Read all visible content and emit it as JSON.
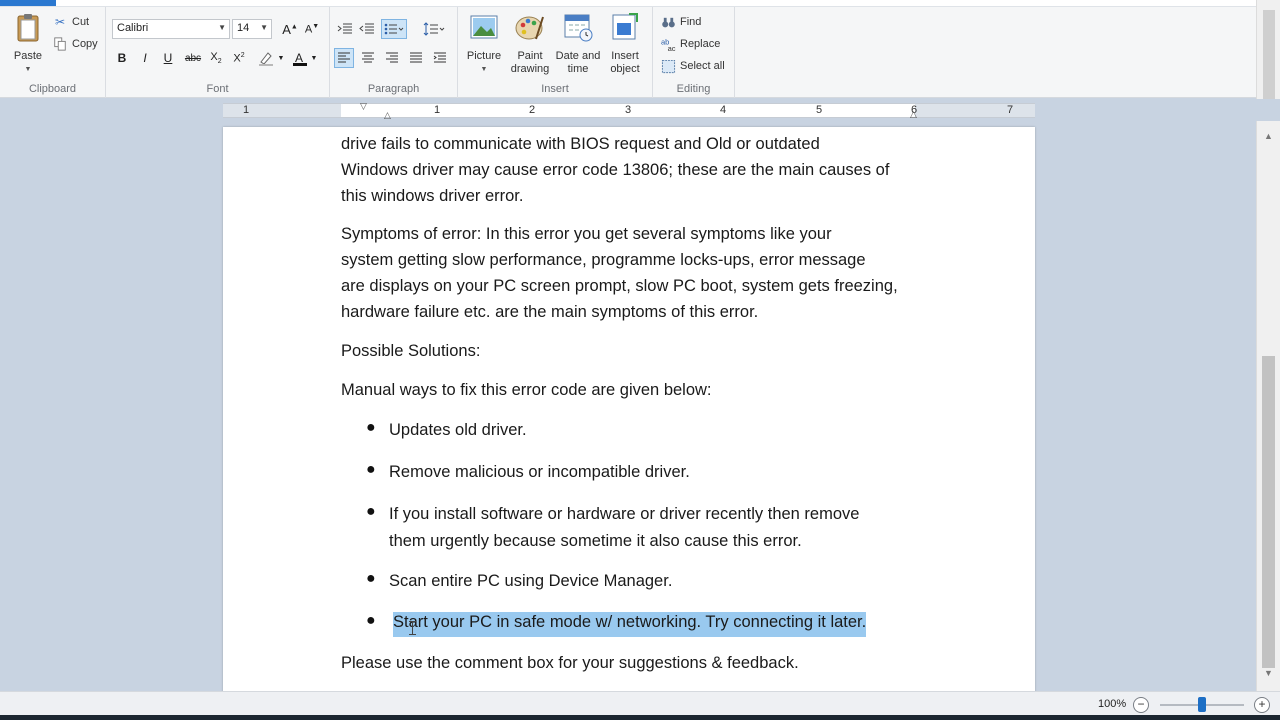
{
  "ribbon": {
    "clipboard": {
      "paste": "Paste",
      "cut": "Cut",
      "copy": "Copy",
      "label": "Clipboard"
    },
    "font": {
      "family": "Calibri",
      "size": "14",
      "label": "Font"
    },
    "paragraph": {
      "label": "Paragraph"
    },
    "insert": {
      "picture": "Picture",
      "paint_drawing": [
        "Paint",
        "drawing"
      ],
      "date_time": [
        "Date and",
        "time"
      ],
      "insert_object": [
        "Insert",
        "object"
      ],
      "label": "Insert"
    },
    "editing": {
      "find": "Find",
      "replace": "Replace",
      "select_all": "Select all",
      "label": "Editing"
    }
  },
  "ruler": {
    "numbers": [
      "1",
      "1",
      "2",
      "3",
      "4",
      "5",
      "6",
      "7"
    ]
  },
  "document": {
    "para1": [
      "drive fails to communicate with BIOS request and Old or outdated",
      "Windows driver may cause error code 13806; these are the main causes of",
      "this windows driver error."
    ],
    "para2": [
      "Symptoms of error: In this error you get several symptoms like your",
      "system getting slow performance, programme locks-ups, error message",
      "are displays on your PC screen prompt, slow PC boot, system gets freezing,",
      "hardware failure etc. are the main symptoms of this error."
    ],
    "para3": "Possible Solutions:",
    "para4": "Manual ways to fix this error code are given below:",
    "bullets": [
      [
        "Updates old driver."
      ],
      [
        "Remove malicious or incompatible driver."
      ],
      [
        "If you install software or hardware or driver recently then remove",
        "them urgently because sometime it also cause this error."
      ],
      [
        "Scan entire PC using Device Manager."
      ],
      [
        "Start your PC in safe mode w/ networking. Try connecting it later."
      ]
    ],
    "closing": "Please use the comment box for your suggestions & feedback."
  },
  "status": {
    "zoom": "100%"
  },
  "colors": {
    "accent": "#2b78d0",
    "selection": "#99c9ef",
    "workspace": "#c8d3e1"
  }
}
